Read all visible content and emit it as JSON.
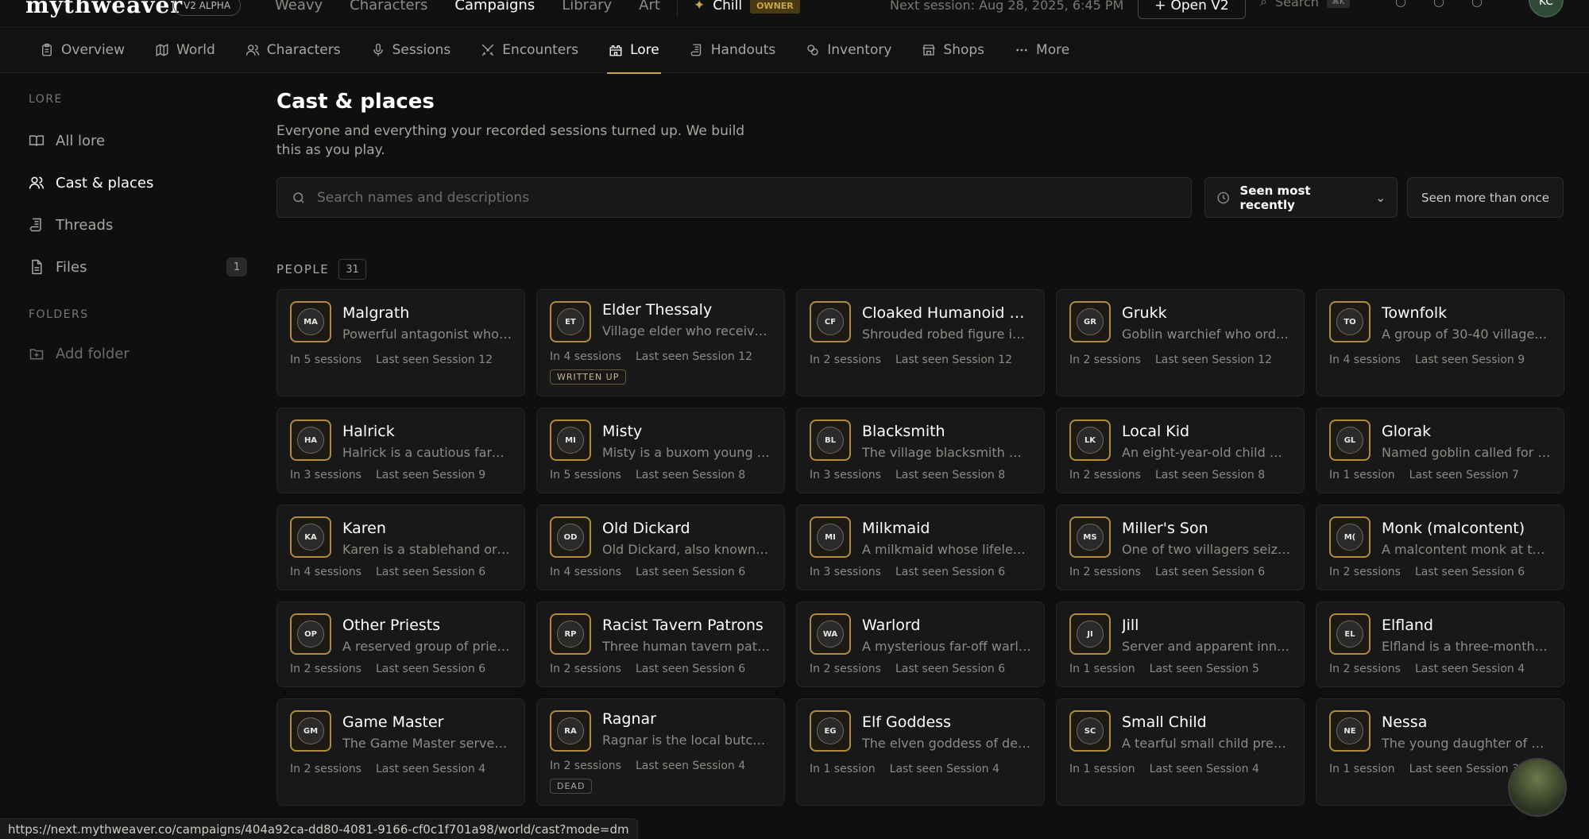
{
  "header": {
    "logo": "mythweaver",
    "beta_badge": "V2 ALPHA",
    "nav": [
      "Weavy",
      "Characters",
      "Campaigns",
      "Library",
      "Art"
    ],
    "active_nav": "Campaigns",
    "campaign_name": "Chill",
    "owner_badge": "OWNER",
    "next_session": "Next session: Aug 28, 2025, 6:45 PM",
    "open_v2_label": "Open V2",
    "search_label": "Search",
    "search_kbd": "⌘K",
    "avatar_initials": "KC"
  },
  "tabs": [
    {
      "label": "Overview",
      "icon": "clipboard-icon"
    },
    {
      "label": "World",
      "icon": "map-icon"
    },
    {
      "label": "Characters",
      "icon": "users-icon"
    },
    {
      "label": "Sessions",
      "icon": "microphone-icon"
    },
    {
      "label": "Encounters",
      "icon": "swords-icon"
    },
    {
      "label": "Lore",
      "icon": "castle-icon",
      "active": true
    },
    {
      "label": "Handouts",
      "icon": "scroll-icon"
    },
    {
      "label": "Inventory",
      "icon": "bag-icon"
    },
    {
      "label": "Shops",
      "icon": "store-icon"
    },
    {
      "label": "More",
      "icon": "ellipsis-icon"
    }
  ],
  "sidebar": {
    "section_lore": "LORE",
    "items": [
      {
        "label": "All lore"
      },
      {
        "label": "Cast & places"
      },
      {
        "label": "Threads"
      },
      {
        "label": "Files",
        "count": "1"
      }
    ],
    "section_folders": "FOLDERS",
    "add_folder": "Add folder"
  },
  "main": {
    "title": "Cast & places",
    "subtitle": "Everyone and everything your recorded sessions turned up. We build this as you play.",
    "search_placeholder": "Search names and descriptions",
    "sort_label": "Seen most recently",
    "filter_label": "Seen more than once",
    "people_label": "PEOPLE",
    "people_count": "31"
  },
  "people": [
    {
      "initials": "MA",
      "name": "Malgrath",
      "desc": "Powerful antagonist who a...",
      "sessions": "In 5 sessions",
      "last_seen": "Last seen Session 12"
    },
    {
      "initials": "ET",
      "name": "Elder Thessaly",
      "desc": "Village elder who receives ...",
      "sessions": "In 4 sessions",
      "last_seen": "Last seen Session 12",
      "badge": "WRITTEN UP"
    },
    {
      "initials": "CF",
      "name": "Cloaked Humanoid Fig...",
      "desc": "Shrouded robed figure in t...",
      "sessions": "In 2 sessions",
      "last_seen": "Last seen Session 12"
    },
    {
      "initials": "GR",
      "name": "Grukk",
      "desc": "Goblin warchief who order...",
      "sessions": "In 2 sessions",
      "last_seen": "Last seen Session 12"
    },
    {
      "initials": "TO",
      "name": "Townfolk",
      "desc": "A group of 30-40 villagers ...",
      "sessions": "In 4 sessions",
      "last_seen": "Last seen Session 9"
    },
    {
      "initials": "HA",
      "name": "Halrick",
      "desc": "Halrick is a cautious farmer...",
      "sessions": "In 3 sessions",
      "last_seen": "Last seen Session 9"
    },
    {
      "initials": "MI",
      "name": "Misty",
      "desc": "Misty is a buxom young wo...",
      "sessions": "In 5 sessions",
      "last_seen": "Last seen Session 8"
    },
    {
      "initials": "BL",
      "name": "Blacksmith",
      "desc": "The village blacksmith who...",
      "sessions": "In 3 sessions",
      "last_seen": "Last seen Session 8"
    },
    {
      "initials": "LK",
      "name": "Local Kid",
      "desc": "An eight-year-old child wh...",
      "sessions": "In 2 sessions",
      "last_seen": "Last seen Session 8"
    },
    {
      "initials": "GL",
      "name": "Glorak",
      "desc": "Named goblin called for by...",
      "sessions": "In 1 session",
      "last_seen": "Last seen Session 7"
    },
    {
      "initials": "KA",
      "name": "Karen",
      "desc": "Karen is a stablehand or o...",
      "sessions": "In 4 sessions",
      "last_seen": "Last seen Session 6"
    },
    {
      "initials": "OD",
      "name": "Old Dickard",
      "desc": "Old Dickard, also known as ...",
      "sessions": "In 4 sessions",
      "last_seen": "Last seen Session 6"
    },
    {
      "initials": "MI",
      "name": "Milkmaid",
      "desc": "A milkmaid whose lifeless ...",
      "sessions": "In 3 sessions",
      "last_seen": "Last seen Session 6"
    },
    {
      "initials": "MS",
      "name": "Miller's Son",
      "desc": "One of two villagers seized...",
      "sessions": "In 2 sessions",
      "last_seen": "Last seen Session 6"
    },
    {
      "initials": "M(",
      "name": "Monk (malcontent)",
      "desc": "A malcontent monk at the ...",
      "sessions": "In 2 sessions",
      "last_seen": "Last seen Session 6"
    },
    {
      "initials": "OP",
      "name": "Other Priests",
      "desc": "A reserved group of priests...",
      "sessions": "In 2 sessions",
      "last_seen": "Last seen Session 6"
    },
    {
      "initials": "RP",
      "name": "Racist Tavern Patrons",
      "desc": "Three human tavern patron...",
      "sessions": "In 2 sessions",
      "last_seen": "Last seen Session 6"
    },
    {
      "initials": "WA",
      "name": "Warlord",
      "desc": "A mysterious far-off warlor...",
      "sessions": "In 2 sessions",
      "last_seen": "Last seen Session 6"
    },
    {
      "initials": "JI",
      "name": "Jill",
      "desc": "Server and apparent innke...",
      "sessions": "In 1 session",
      "last_seen": "Last seen Session 5"
    },
    {
      "initials": "EL",
      "name": "Elfland",
      "desc": "Elfland is a three-month re...",
      "sessions": "In 2 sessions",
      "last_seen": "Last seen Session 4"
    },
    {
      "initials": "GM",
      "name": "Game Master",
      "desc": "The Game Master serves a...",
      "sessions": "In 2 sessions",
      "last_seen": "Last seen Session 4"
    },
    {
      "initials": "RA",
      "name": "Ragnar",
      "desc": "Ragnar is the local butcher...",
      "sessions": "In 2 sessions",
      "last_seen": "Last seen Session 4",
      "badge": "DEAD"
    },
    {
      "initials": "EG",
      "name": "Elf Goddess",
      "desc": "The elven goddess of deat...",
      "sessions": "In 1 session",
      "last_seen": "Last seen Session 4"
    },
    {
      "initials": "SC",
      "name": "Small Child",
      "desc": "A tearful small child presen...",
      "sessions": "In 1 session",
      "last_seen": "Last seen Session 4"
    },
    {
      "initials": "NE",
      "name": "Nessa",
      "desc": "The young daughter of Hal...",
      "sessions": "In 1 session",
      "last_seen": "Last seen Session 3"
    }
  ],
  "status_url": "https://next.mythweaver.co/campaigns/404a92ca-dd80-4081-9166-cf0c1f701a98/world/cast?mode=dm",
  "colors": {
    "background": "#0f0f0f",
    "card": "#181818",
    "accent_gold": "#c9a44a",
    "text_muted": "#8d8a84"
  }
}
